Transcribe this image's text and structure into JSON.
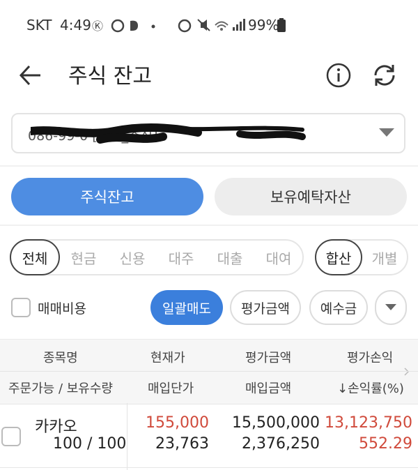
{
  "status_bar": {
    "carrier": "SKT",
    "time": "4:49",
    "battery": "99%"
  },
  "header": {
    "title": "주식 잔고",
    "back_icon": "arrow-left-icon",
    "info_icon": "info-circle-icon",
    "refresh_icon": "refresh-icon"
  },
  "account": {
    "value": "086-99-0            [종합_주식]"
  },
  "main_tabs": [
    {
      "label": "주식잔고",
      "active": true
    },
    {
      "label": "보유예탁자산",
      "active": false
    }
  ],
  "type_filters": [
    {
      "label": "전체",
      "selected": true
    },
    {
      "label": "현금",
      "selected": false
    },
    {
      "label": "신용",
      "selected": false
    },
    {
      "label": "대주",
      "selected": false
    },
    {
      "label": "대출",
      "selected": false
    },
    {
      "label": "대여",
      "selected": false
    }
  ],
  "view_filters": [
    {
      "label": "합산",
      "selected": true
    },
    {
      "label": "개별",
      "selected": false
    }
  ],
  "options": {
    "fee_checkbox_label": "매매비용",
    "bulk_sell": "일괄매도",
    "eval_amount": "평가금액",
    "deposit": "예수금"
  },
  "table": {
    "header_row1": [
      "종목명",
      "현재가",
      "평가금액",
      "평가손익"
    ],
    "header_row2": [
      "주문가능 / 보유수량",
      "매입단가",
      "매입금액",
      "↓손익률(%)"
    ],
    "rows": [
      {
        "name": "카카오",
        "quantity": "100 / 100",
        "current_price": "155,000",
        "avg_price": "23,763",
        "eval_amount": "15,500,000",
        "purchase_amount": "2,376,250",
        "profit": "13,123,750",
        "profit_rate": "552.29"
      }
    ]
  },
  "colors": {
    "accent": "#4e8de2",
    "gain": "#d04a3b"
  }
}
